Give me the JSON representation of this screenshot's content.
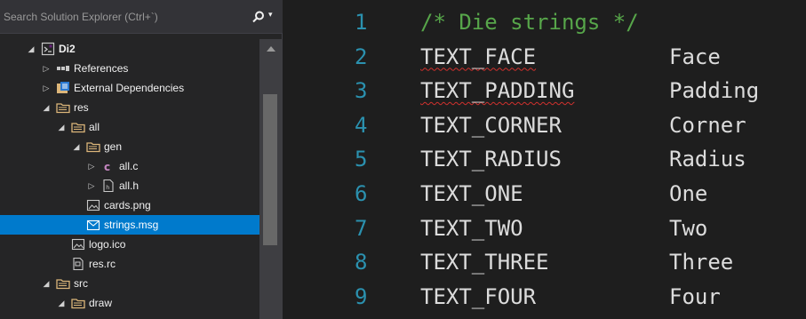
{
  "explorer": {
    "search_placeholder": "Search Solution Explorer (Ctrl+`)",
    "tree": [
      {
        "label": "Di2",
        "indent": 1,
        "expander": "expanded",
        "icon": "solution-project-icon",
        "bold": true
      },
      {
        "label": "References",
        "indent": 2,
        "expander": "collapsed",
        "icon": "references-icon"
      },
      {
        "label": "External Dependencies",
        "indent": 2,
        "expander": "collapsed",
        "icon": "external-dependencies-icon"
      },
      {
        "label": "res",
        "indent": 2,
        "expander": "expanded",
        "icon": "filter-folder-icon"
      },
      {
        "label": "all",
        "indent": 3,
        "expander": "expanded",
        "icon": "filter-folder-icon"
      },
      {
        "label": "gen",
        "indent": 4,
        "expander": "expanded",
        "icon": "filter-folder-icon"
      },
      {
        "label": "all.c",
        "indent": 5,
        "expander": "collapsed",
        "icon": "c-source-file-icon"
      },
      {
        "label": "all.h",
        "indent": 5,
        "expander": "collapsed",
        "icon": "header-file-icon"
      },
      {
        "label": "cards.png",
        "indent": 4,
        "expander": "none",
        "icon": "image-file-icon"
      },
      {
        "label": "strings.msg",
        "indent": 4,
        "expander": "none",
        "icon": "message-file-icon",
        "selected": true
      },
      {
        "label": "logo.ico",
        "indent": 3,
        "expander": "none",
        "icon": "image-file-icon"
      },
      {
        "label": "res.rc",
        "indent": 3,
        "expander": "none",
        "icon": "resource-file-icon"
      },
      {
        "label": "src",
        "indent": 2,
        "expander": "expanded",
        "icon": "filter-folder-icon"
      },
      {
        "label": "draw",
        "indent": 3,
        "expander": "expanded",
        "icon": "filter-folder-icon"
      }
    ]
  },
  "editor": {
    "lines": [
      {
        "num": "1",
        "code": "/* Die strings */",
        "value": "",
        "comment": true
      },
      {
        "num": "2",
        "code": "TEXT_FACE",
        "value": "Face",
        "squiggle": true
      },
      {
        "num": "3",
        "code": "TEXT_PADDING",
        "value": "Padding",
        "squiggle": true
      },
      {
        "num": "4",
        "code": "TEXT_CORNER",
        "value": "Corner"
      },
      {
        "num": "5",
        "code": "TEXT_RADIUS",
        "value": "Radius"
      },
      {
        "num": "6",
        "code": "TEXT_ONE",
        "value": "One"
      },
      {
        "num": "7",
        "code": "TEXT_TWO",
        "value": "Two"
      },
      {
        "num": "8",
        "code": "TEXT_THREE",
        "value": "Three"
      },
      {
        "num": "9",
        "code": "TEXT_FOUR",
        "value": "Four"
      }
    ]
  },
  "colors": {
    "selection": "#007acc",
    "line_number": "#2b91af",
    "comment": "#57a64a",
    "text": "#dcdcdc",
    "squiggle": "#d0312d"
  }
}
